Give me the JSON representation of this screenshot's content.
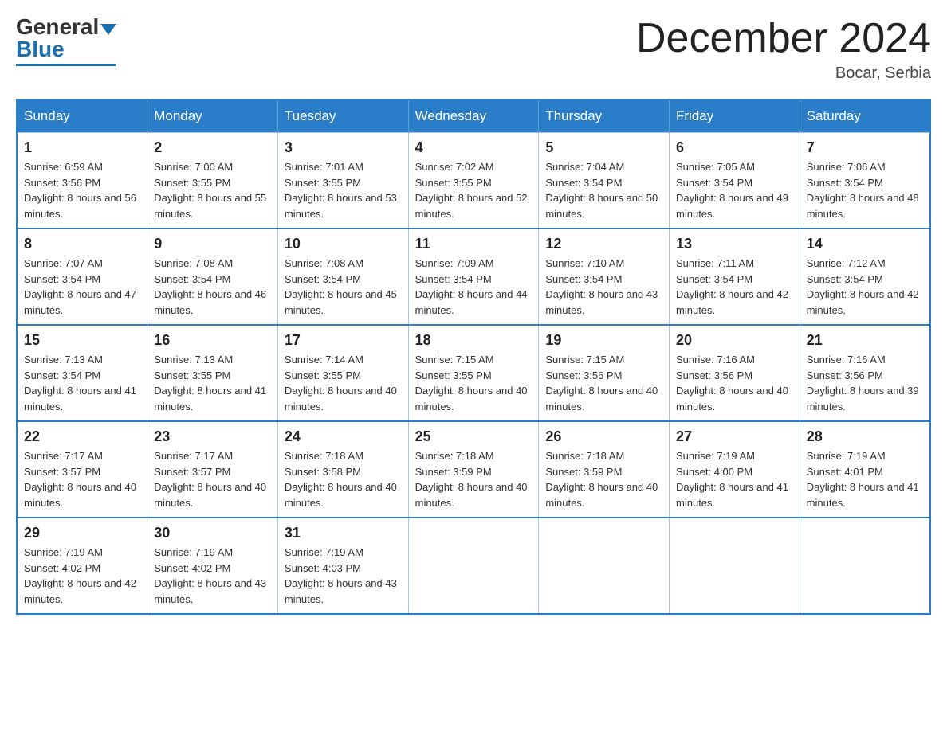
{
  "header": {
    "logo_general": "General",
    "logo_blue": "Blue",
    "month_title": "December 2024",
    "location": "Bocar, Serbia"
  },
  "weekdays": [
    "Sunday",
    "Monday",
    "Tuesday",
    "Wednesday",
    "Thursday",
    "Friday",
    "Saturday"
  ],
  "weeks": [
    [
      {
        "day": "1",
        "sunrise": "6:59 AM",
        "sunset": "3:56 PM",
        "daylight": "8 hours and 56 minutes."
      },
      {
        "day": "2",
        "sunrise": "7:00 AM",
        "sunset": "3:55 PM",
        "daylight": "8 hours and 55 minutes."
      },
      {
        "day": "3",
        "sunrise": "7:01 AM",
        "sunset": "3:55 PM",
        "daylight": "8 hours and 53 minutes."
      },
      {
        "day": "4",
        "sunrise": "7:02 AM",
        "sunset": "3:55 PM",
        "daylight": "8 hours and 52 minutes."
      },
      {
        "day": "5",
        "sunrise": "7:04 AM",
        "sunset": "3:54 PM",
        "daylight": "8 hours and 50 minutes."
      },
      {
        "day": "6",
        "sunrise": "7:05 AM",
        "sunset": "3:54 PM",
        "daylight": "8 hours and 49 minutes."
      },
      {
        "day": "7",
        "sunrise": "7:06 AM",
        "sunset": "3:54 PM",
        "daylight": "8 hours and 48 minutes."
      }
    ],
    [
      {
        "day": "8",
        "sunrise": "7:07 AM",
        "sunset": "3:54 PM",
        "daylight": "8 hours and 47 minutes."
      },
      {
        "day": "9",
        "sunrise": "7:08 AM",
        "sunset": "3:54 PM",
        "daylight": "8 hours and 46 minutes."
      },
      {
        "day": "10",
        "sunrise": "7:08 AM",
        "sunset": "3:54 PM",
        "daylight": "8 hours and 45 minutes."
      },
      {
        "day": "11",
        "sunrise": "7:09 AM",
        "sunset": "3:54 PM",
        "daylight": "8 hours and 44 minutes."
      },
      {
        "day": "12",
        "sunrise": "7:10 AM",
        "sunset": "3:54 PM",
        "daylight": "8 hours and 43 minutes."
      },
      {
        "day": "13",
        "sunrise": "7:11 AM",
        "sunset": "3:54 PM",
        "daylight": "8 hours and 42 minutes."
      },
      {
        "day": "14",
        "sunrise": "7:12 AM",
        "sunset": "3:54 PM",
        "daylight": "8 hours and 42 minutes."
      }
    ],
    [
      {
        "day": "15",
        "sunrise": "7:13 AM",
        "sunset": "3:54 PM",
        "daylight": "8 hours and 41 minutes."
      },
      {
        "day": "16",
        "sunrise": "7:13 AM",
        "sunset": "3:55 PM",
        "daylight": "8 hours and 41 minutes."
      },
      {
        "day": "17",
        "sunrise": "7:14 AM",
        "sunset": "3:55 PM",
        "daylight": "8 hours and 40 minutes."
      },
      {
        "day": "18",
        "sunrise": "7:15 AM",
        "sunset": "3:55 PM",
        "daylight": "8 hours and 40 minutes."
      },
      {
        "day": "19",
        "sunrise": "7:15 AM",
        "sunset": "3:56 PM",
        "daylight": "8 hours and 40 minutes."
      },
      {
        "day": "20",
        "sunrise": "7:16 AM",
        "sunset": "3:56 PM",
        "daylight": "8 hours and 40 minutes."
      },
      {
        "day": "21",
        "sunrise": "7:16 AM",
        "sunset": "3:56 PM",
        "daylight": "8 hours and 39 minutes."
      }
    ],
    [
      {
        "day": "22",
        "sunrise": "7:17 AM",
        "sunset": "3:57 PM",
        "daylight": "8 hours and 40 minutes."
      },
      {
        "day": "23",
        "sunrise": "7:17 AM",
        "sunset": "3:57 PM",
        "daylight": "8 hours and 40 minutes."
      },
      {
        "day": "24",
        "sunrise": "7:18 AM",
        "sunset": "3:58 PM",
        "daylight": "8 hours and 40 minutes."
      },
      {
        "day": "25",
        "sunrise": "7:18 AM",
        "sunset": "3:59 PM",
        "daylight": "8 hours and 40 minutes."
      },
      {
        "day": "26",
        "sunrise": "7:18 AM",
        "sunset": "3:59 PM",
        "daylight": "8 hours and 40 minutes."
      },
      {
        "day": "27",
        "sunrise": "7:19 AM",
        "sunset": "4:00 PM",
        "daylight": "8 hours and 41 minutes."
      },
      {
        "day": "28",
        "sunrise": "7:19 AM",
        "sunset": "4:01 PM",
        "daylight": "8 hours and 41 minutes."
      }
    ],
    [
      {
        "day": "29",
        "sunrise": "7:19 AM",
        "sunset": "4:02 PM",
        "daylight": "8 hours and 42 minutes."
      },
      {
        "day": "30",
        "sunrise": "7:19 AM",
        "sunset": "4:02 PM",
        "daylight": "8 hours and 43 minutes."
      },
      {
        "day": "31",
        "sunrise": "7:19 AM",
        "sunset": "4:03 PM",
        "daylight": "8 hours and 43 minutes."
      },
      null,
      null,
      null,
      null
    ]
  ]
}
